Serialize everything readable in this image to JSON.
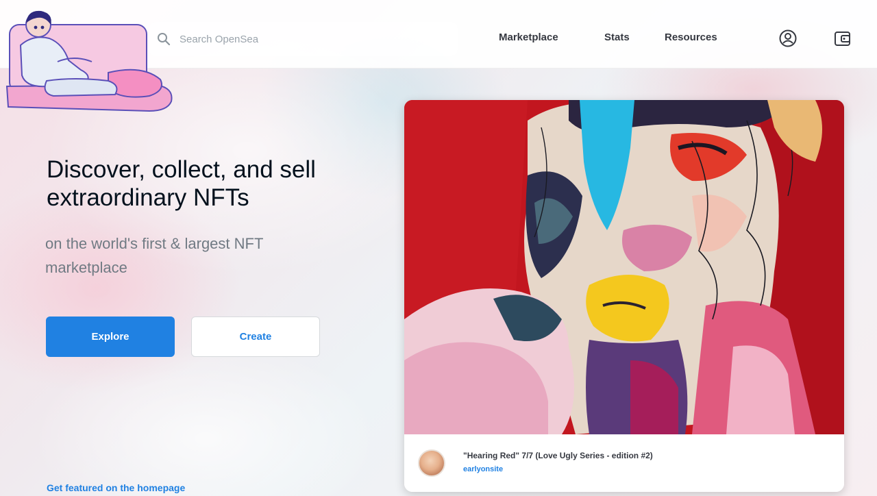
{
  "header": {
    "search_placeholder": "Search OpenSea",
    "nav": {
      "marketplace": "Marketplace",
      "stats": "Stats",
      "resources": "Resources"
    },
    "icons": {
      "logo": "illustration-person-on-sofa-icon",
      "search": "search-icon",
      "account": "account-icon",
      "wallet": "wallet-icon"
    }
  },
  "hero": {
    "title": "Discover, collect, and sell extraordinary NFTs",
    "subtitle": "on the world's first & largest NFT marketplace",
    "explore_label": "Explore",
    "create_label": "Create",
    "featured_link": "Get featured on the homepage"
  },
  "featured_card": {
    "title": "\"Hearing Red\" 7/7 (Love Ugly Series - edition #2)",
    "creator": "earlyonsite"
  },
  "colors": {
    "accent": "#2081e2",
    "text_dark": "#04111d",
    "text_muted": "#707a83"
  }
}
